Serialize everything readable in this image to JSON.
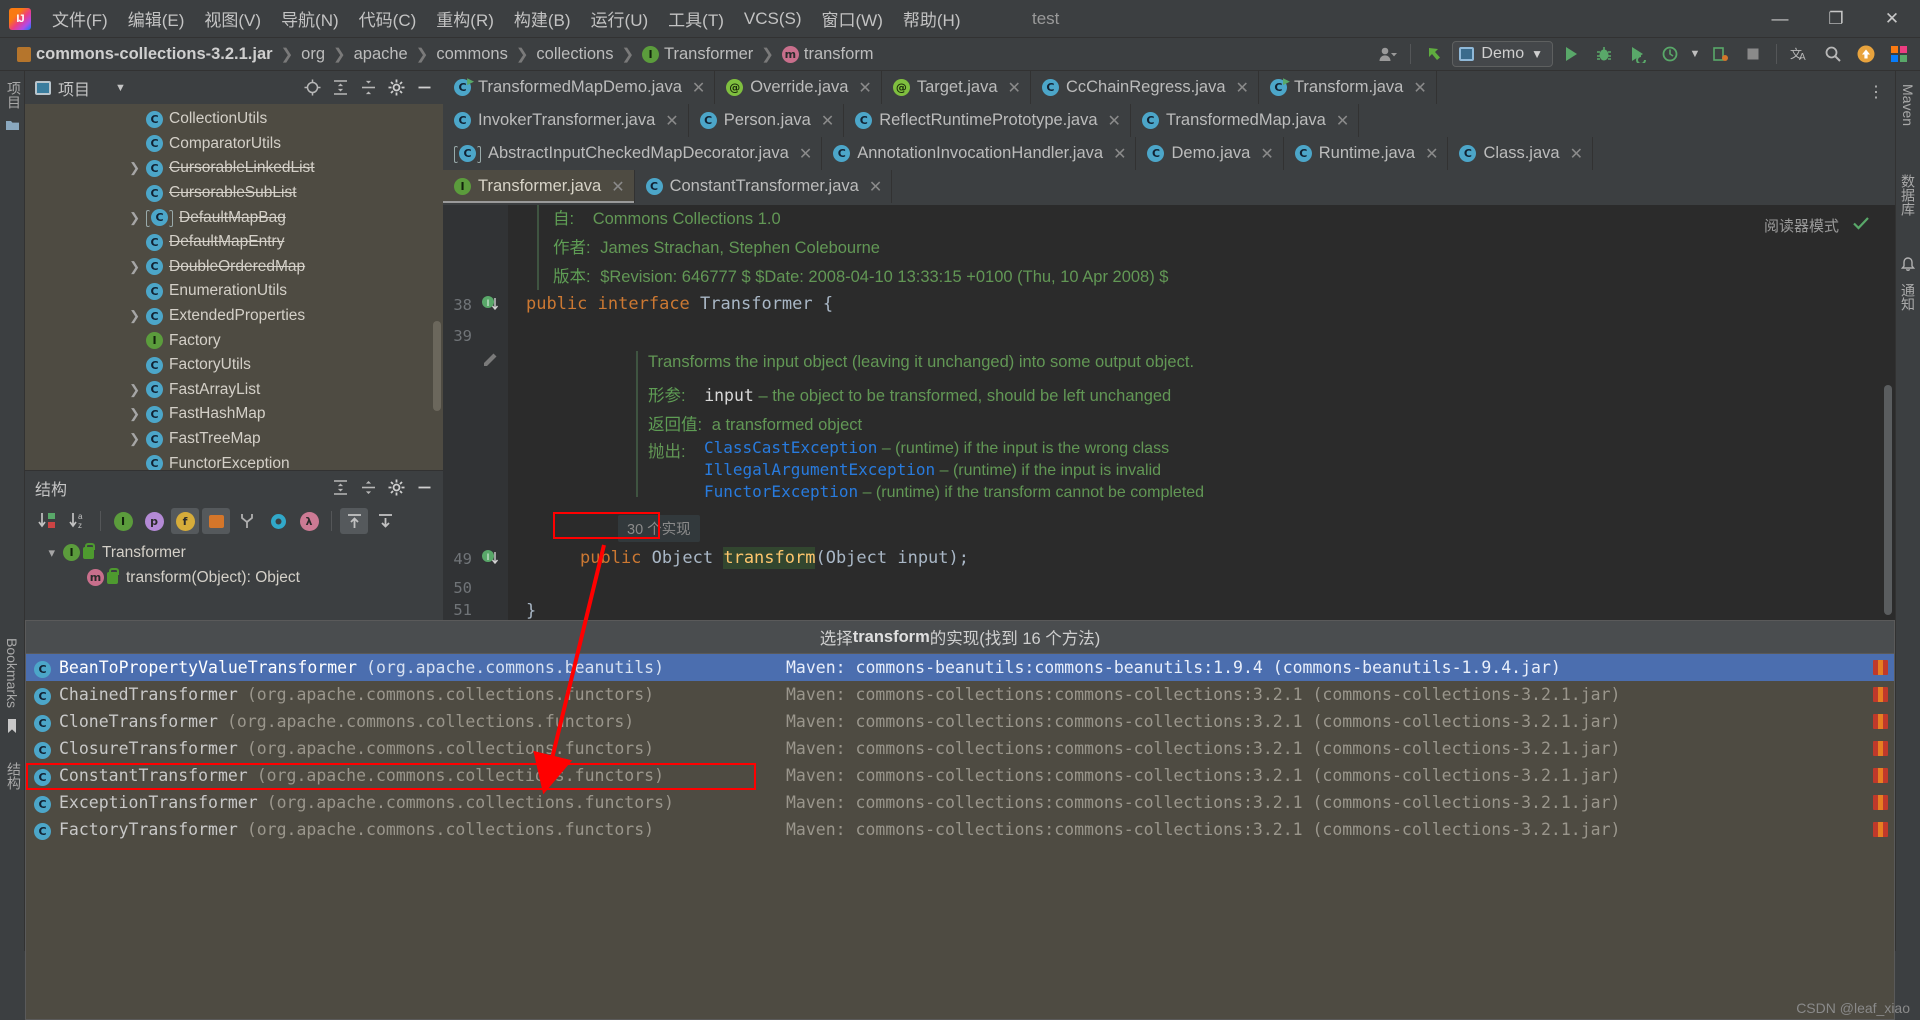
{
  "window": {
    "title": "test",
    "logo_icon": "intellij-idea-logo",
    "controls": [
      {
        "name": "minimize-button",
        "glyph": "—"
      },
      {
        "name": "maximize-button",
        "glyph": "❐"
      },
      {
        "name": "close-button",
        "glyph": "✕"
      }
    ]
  },
  "menubar": [
    {
      "label": "文件(F)"
    },
    {
      "label": "编辑(E)"
    },
    {
      "label": "视图(V)"
    },
    {
      "label": "导航(N)"
    },
    {
      "label": "代码(C)"
    },
    {
      "label": "重构(R)"
    },
    {
      "label": "构建(B)"
    },
    {
      "label": "运行(U)"
    },
    {
      "label": "工具(T)"
    },
    {
      "label": "VCS(S)"
    },
    {
      "label": "窗口(W)"
    },
    {
      "label": "帮助(H)"
    }
  ],
  "breadcrumbs": [
    {
      "label": "commons-collections-3.2.1.jar",
      "icon": "jar-file-icon",
      "bold": true
    },
    {
      "label": "org",
      "icon": "package-icon",
      "bold": false
    },
    {
      "label": "apache",
      "icon": "package-icon",
      "bold": false
    },
    {
      "label": "commons",
      "icon": "package-icon",
      "bold": false
    },
    {
      "label": "collections",
      "icon": "package-icon",
      "bold": false
    },
    {
      "label": "Transformer",
      "icon": "interface-icon",
      "bold": false
    },
    {
      "label": "transform",
      "icon": "method-icon",
      "bold": false
    }
  ],
  "toolbar": {
    "run_config": "Demo",
    "run_config_icon": "run-config-icon",
    "buttons": [
      {
        "name": "user-settings-button",
        "icon": "user-icon"
      },
      {
        "name": "update-project-button",
        "icon": "vcs-update-icon"
      },
      {
        "name": "run-button",
        "icon": "play-icon"
      },
      {
        "name": "debug-button",
        "icon": "bug-icon"
      },
      {
        "name": "run-with-coverage-button",
        "icon": "coverage-icon"
      },
      {
        "name": "profile-button",
        "icon": "profiler-icon"
      },
      {
        "name": "attach-process-button",
        "icon": "attach-icon"
      },
      {
        "name": "stop-button",
        "icon": "stop-icon"
      },
      {
        "name": "translate-button",
        "icon": "translate-icon"
      },
      {
        "name": "search-everywhere-button",
        "icon": "search-icon"
      },
      {
        "name": "notifications-button",
        "icon": "update-arrow-icon"
      },
      {
        "name": "ide-features-button",
        "icon": "ide-icon"
      }
    ]
  },
  "left_stripe": [
    {
      "label": "项目",
      "name": "stripe-project"
    },
    {
      "label": "结构",
      "name": "stripe-structure"
    },
    {
      "label": "Bookmarks",
      "name": "stripe-bookmarks"
    }
  ],
  "right_stripe": [
    {
      "label": "Maven",
      "name": "stripe-maven"
    },
    {
      "label": "数据库",
      "name": "stripe-database"
    },
    {
      "label": "通知",
      "name": "stripe-notifications"
    }
  ],
  "project_panel": {
    "title": "项目",
    "dropdown_icon": "chevron-down-icon",
    "actions": [
      {
        "name": "locate-file-icon"
      },
      {
        "name": "expand-all-icon"
      },
      {
        "name": "collapse-all-icon"
      },
      {
        "name": "settings-gear-icon"
      },
      {
        "name": "hide-panel-icon"
      }
    ],
    "tree": [
      {
        "label": "CollectionUtils",
        "icon": "class-icon",
        "arrow": false,
        "deprecated": false
      },
      {
        "label": "ComparatorUtils",
        "icon": "class-icon",
        "arrow": false,
        "deprecated": false
      },
      {
        "label": "CursorableLinkedList",
        "icon": "class-icon",
        "arrow": true,
        "deprecated": true
      },
      {
        "label": "CursorableSubList",
        "icon": "class-icon",
        "arrow": false,
        "deprecated": true
      },
      {
        "label": "DefaultMapBag",
        "icon": "abstract-class-icon",
        "arrow": true,
        "deprecated": true
      },
      {
        "label": "DefaultMapEntry",
        "icon": "class-icon",
        "arrow": false,
        "deprecated": true
      },
      {
        "label": "DoubleOrderedMap",
        "icon": "class-icon",
        "arrow": true,
        "deprecated": true
      },
      {
        "label": "EnumerationUtils",
        "icon": "class-icon",
        "arrow": false,
        "deprecated": false
      },
      {
        "label": "ExtendedProperties",
        "icon": "class-icon",
        "arrow": true,
        "deprecated": false
      },
      {
        "label": "Factory",
        "icon": "interface-icon",
        "arrow": false,
        "deprecated": false
      },
      {
        "label": "FactoryUtils",
        "icon": "class-icon",
        "arrow": false,
        "deprecated": false
      },
      {
        "label": "FastArrayList",
        "icon": "class-icon",
        "arrow": true,
        "deprecated": false
      },
      {
        "label": "FastHashMap",
        "icon": "class-icon",
        "arrow": true,
        "deprecated": false
      },
      {
        "label": "FastTreeMap",
        "icon": "class-icon",
        "arrow": true,
        "deprecated": false
      },
      {
        "label": "FunctorException",
        "icon": "class-icon",
        "arrow": false,
        "deprecated": false
      }
    ]
  },
  "structure_panel": {
    "title": "结构",
    "head_actions": [
      {
        "name": "expand-all-icon"
      },
      {
        "name": "collapse-all-icon"
      },
      {
        "name": "settings-gear-icon"
      },
      {
        "name": "hide-panel-icon"
      }
    ],
    "toolbar": [
      {
        "name": "sort-by-visibility-icon",
        "glyph": "↓",
        "active": false
      },
      {
        "name": "sort-alphabetically-icon",
        "glyph": "↓",
        "active": false
      },
      {
        "name": "show-inherited-icon",
        "active": false
      },
      {
        "name": "show-properties-icon",
        "active": false
      },
      {
        "name": "show-fields-icon",
        "active": true
      },
      {
        "name": "show-non-public-icon",
        "active": true
      },
      {
        "name": "show-anonymous-icon",
        "active": false
      },
      {
        "name": "group-methods-icon",
        "active": false
      },
      {
        "name": "show-lambdas-icon",
        "active": false
      },
      {
        "name": "expand-all-icon",
        "active": true
      },
      {
        "name": "collapse-all-icon",
        "active": false
      }
    ],
    "tree": [
      {
        "label": "Transformer",
        "icon": "interface-icon",
        "badge": "public-icon",
        "arrow": "expanded",
        "indent": 0
      },
      {
        "label": "transform(Object): Object",
        "icon": "method-icon",
        "badge": "public-icon",
        "arrow": "none",
        "indent": 1
      }
    ]
  },
  "editor_tabs": [
    [
      {
        "label": "TransformedMapDemo.java",
        "icon": "class-run-icon",
        "selected": false
      },
      {
        "label": "Override.java",
        "icon": "annotation-icon",
        "selected": false
      },
      {
        "label": "Target.java",
        "icon": "annotation-icon",
        "selected": false
      },
      {
        "label": "CcChainRegress.java",
        "icon": "class-icon",
        "selected": false
      },
      {
        "label": "Transform.java",
        "icon": "class-run-icon",
        "selected": false
      }
    ],
    [
      {
        "label": "InvokerTransformer.java",
        "icon": "class-icon",
        "selected": false
      },
      {
        "label": "Person.java",
        "icon": "class-icon",
        "selected": false
      },
      {
        "label": "ReflectRuntimePrototype.java",
        "icon": "class-icon",
        "selected": false
      },
      {
        "label": "TransformedMap.java",
        "icon": "class-icon",
        "selected": false
      }
    ],
    [
      {
        "label": "AbstractInputCheckedMapDecorator.java",
        "icon": "abstract-class-icon",
        "selected": false
      },
      {
        "label": "AnnotationInvocationHandler.java",
        "icon": "class-icon",
        "selected": false
      },
      {
        "label": "Demo.java",
        "icon": "class-icon",
        "selected": false
      },
      {
        "label": "Runtime.java",
        "icon": "class-icon",
        "selected": false
      },
      {
        "label": "Class.java",
        "icon": "class-icon",
        "selected": false
      }
    ],
    [
      {
        "label": "Transformer.java",
        "icon": "interface-icon",
        "selected": true
      },
      {
        "label": "ConstantTransformer.java",
        "icon": "class-icon",
        "selected": false
      }
    ]
  ],
  "tabs_more_icon": "more-options-icon",
  "editor": {
    "reader_mode_label": "阅读器模式",
    "inspection_icon": "inspection-ok-icon",
    "class_doc": [
      {
        "label": "自:",
        "text": "Commons Collections 1.0"
      },
      {
        "label": "作者:",
        "text": "James Strachan, Stephen Colebourne"
      },
      {
        "label": "版本:",
        "text": "$Revision: 646777 $ $Date: 2008-04-10 13:33:15 +0100 (Thu, 10 Apr 2008) $"
      }
    ],
    "line_38": {
      "num": "38",
      "code_kw1": "public",
      "code_kw2": "interface",
      "code_type": "Transformer",
      "code_brace": "{"
    },
    "line_39": {
      "num": "39"
    },
    "method_doc_summary": "Transforms the input object (leaving it unchanged) into some output object.",
    "method_doc_rows": [
      {
        "label": "形参:",
        "mono": "input",
        "rest": " – the object to be transformed, should be left unchanged"
      },
      {
        "label": "返回值:",
        "mono": "",
        "rest": "a transformed object"
      }
    ],
    "throws_label": "抛出:",
    "throws_rows": [
      {
        "type": "ClassCastException",
        "rest": " – (runtime) if the input is the wrong class"
      },
      {
        "type": "IllegalArgumentException",
        "rest": " – (runtime) if the input is invalid"
      },
      {
        "type": "FunctorException",
        "rest": " – (runtime) if the transform cannot be completed"
      }
    ],
    "implementations_hint": "30 个实现",
    "line_49": {
      "num": "49",
      "kw": "public",
      "ret": "Object",
      "name": "transform",
      "args": "(Object input);"
    },
    "line_50": {
      "num": "50"
    },
    "line_51": {
      "num": "51",
      "code": "}"
    }
  },
  "popup": {
    "header_prefix": "选择 ",
    "header_bold": "transform",
    "header_suffix": " 的实现(找到 16 个方法)",
    "rows": [
      {
        "name": "BeanToPropertyValueTransformer",
        "package": "(org.apache.commons.beanutils)",
        "maven": "Maven: commons-beanutils:commons-beanutils:1.9.4 (commons-beanutils-1.9.4.jar)",
        "icon": "class-icon",
        "selected": true,
        "highlighted": false
      },
      {
        "name": "ChainedTransformer",
        "package": "(org.apache.commons.collections.functors)",
        "maven": "Maven: commons-collections:commons-collections:3.2.1 (commons-collections-3.2.1.jar)",
        "icon": "class-icon",
        "selected": false,
        "highlighted": false
      },
      {
        "name": "CloneTransformer",
        "package": "(org.apache.commons.collections.functors)",
        "maven": "Maven: commons-collections:commons-collections:3.2.1 (commons-collections-3.2.1.jar)",
        "icon": "class-icon",
        "selected": false,
        "highlighted": false
      },
      {
        "name": "ClosureTransformer",
        "package": "(org.apache.commons.collections.functors)",
        "maven": "Maven: commons-collections:commons-collections:3.2.1 (commons-collections-3.2.1.jar)",
        "icon": "class-icon",
        "selected": false,
        "highlighted": false
      },
      {
        "name": "ConstantTransformer",
        "package": "(org.apache.commons.collections.functors)",
        "maven": "Maven: commons-collections:commons-collections:3.2.1 (commons-collections-3.2.1.jar)",
        "icon": "class-icon",
        "selected": false,
        "highlighted": true
      },
      {
        "name": "ExceptionTransformer",
        "package": "(org.apache.commons.collections.functors)",
        "maven": "Maven: commons-collections:commons-collections:3.2.1 (commons-collections-3.2.1.jar)",
        "icon": "class-icon",
        "selected": false,
        "highlighted": false
      },
      {
        "name": "FactoryTransformer",
        "package": "(org.apache.commons.collections.functors)",
        "maven": "Maven: commons-collections:commons-collections:3.2.1 (commons-collections-3.2.1.jar)",
        "icon": "class-icon",
        "selected": false,
        "highlighted": false
      }
    ]
  },
  "annotations": {
    "watermark": "CSDN @leaf_xiao",
    "red_color": "#ff0000"
  }
}
